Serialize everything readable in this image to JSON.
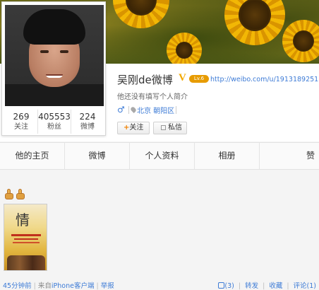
{
  "profile": {
    "name": "吴刚de微博",
    "verified_mark": "V",
    "level_badge": "Lv.6",
    "url": "http://weibo.com/u/1913189251",
    "bio": "他还没有填写个人简介",
    "gender_symbol": "♂",
    "location": "北京 朝阳区"
  },
  "stats": [
    {
      "value": "269",
      "label": "关注"
    },
    {
      "value": "405553",
      "label": "粉丝"
    },
    {
      "value": "224",
      "label": "微博"
    }
  ],
  "buttons": {
    "follow_plus": "+",
    "follow_label": "关注",
    "message_label": "私信"
  },
  "tabs": [
    "他的主页",
    "微博",
    "个人资料",
    "相册",
    "赞"
  ],
  "post": {
    "poster_glyph": "情",
    "time": "45分钟前",
    "source_prefix": "来自",
    "source": "iPhone客户端",
    "report": "举报",
    "likes": "(3)",
    "repost": "转发",
    "favorite": "收藏",
    "comment": "评论(1)"
  },
  "colors": {
    "link": "#3d7bd6",
    "accent": "#f08000",
    "badge": "#e79b00"
  }
}
